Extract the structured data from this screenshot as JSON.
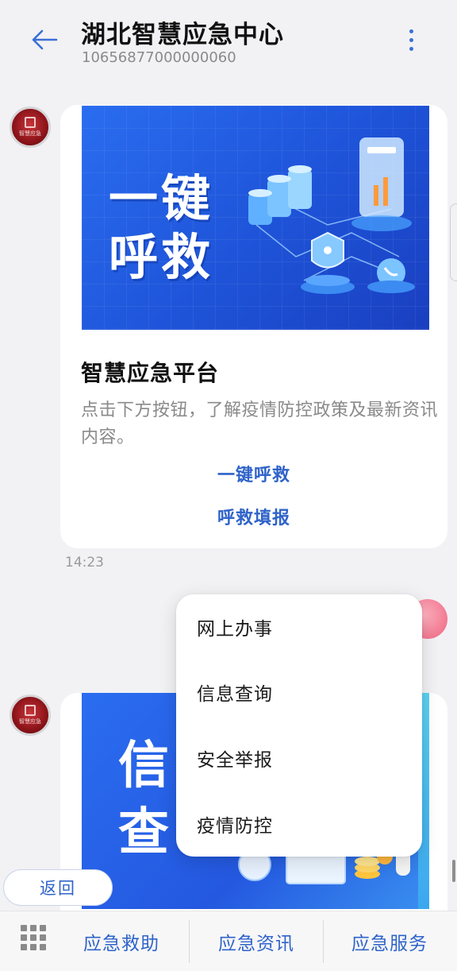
{
  "header": {
    "title": "湖北智慧应急中心",
    "subtitle": "10656877000000060"
  },
  "avatar": {
    "label": "智慧应急"
  },
  "card1": {
    "banner_text_line1": "一键",
    "banner_text_line2": "呼救",
    "title": "智慧应急平台",
    "description": "点击下方按钮，了解疫情防控政策及最新资讯内容。",
    "links": [
      "一键呼救",
      "呼救填报"
    ],
    "timestamp": "14:23"
  },
  "card2": {
    "banner_text_line1": "信",
    "banner_text_line2": "查"
  },
  "menu": {
    "items": [
      "网上办事",
      "信息查询",
      "安全举报",
      "疫情防控"
    ]
  },
  "return_button": {
    "label": "返回"
  },
  "bottom_bar": {
    "tabs": [
      "应急救助",
      "应急资讯",
      "应急服务"
    ]
  },
  "colors": {
    "accent": "#2f63c9",
    "banner_blue": "#1e53d8",
    "background": "#f2f2f4"
  }
}
